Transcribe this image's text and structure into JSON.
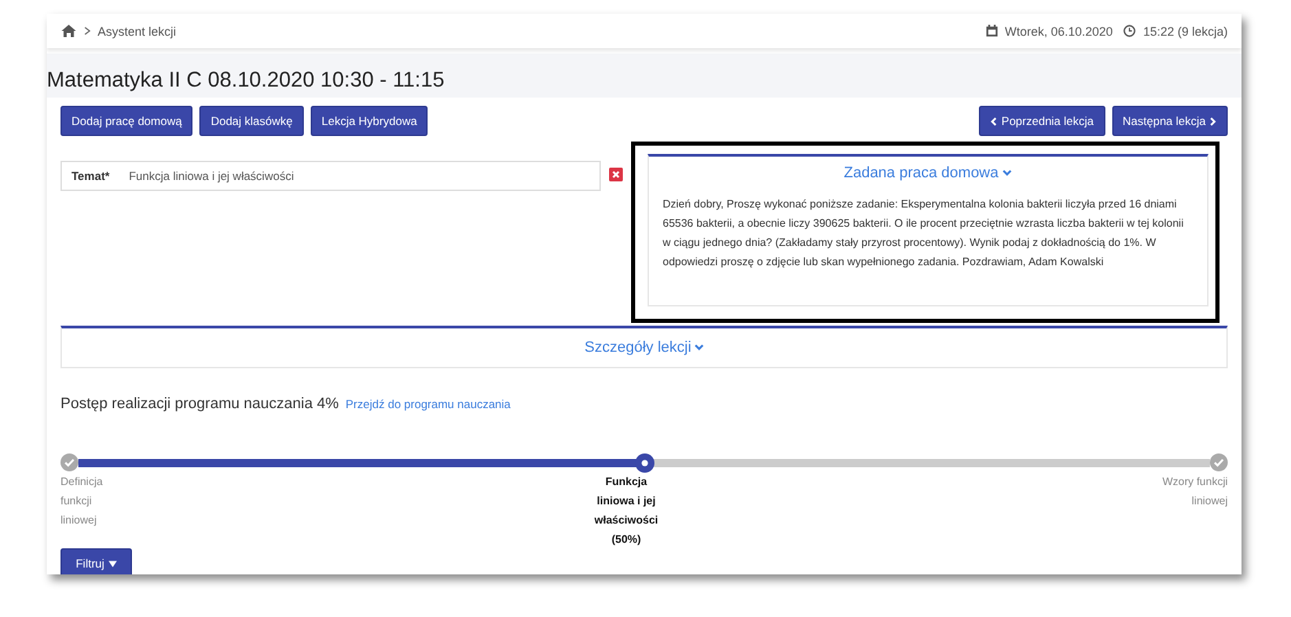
{
  "breadcrumb": {
    "current": "Asystent lekcji"
  },
  "header_info": {
    "date": "Wtorek, 06.10.2020",
    "time": "15:22 (9 lekcja)"
  },
  "title": "Matematyka II C 08.10.2020 10:30 - 11:15",
  "left_buttons": [
    "Dodaj pracę domową",
    "Dodaj klasówkę",
    "Lekcja Hybrydowa"
  ],
  "nav_buttons": [
    {
      "label": "Poprzednia lekcja",
      "kind": "prev"
    },
    {
      "label": "Następna lekcja",
      "kind": "next"
    }
  ],
  "topic": {
    "label": "Temat*",
    "value": "Funkcja liniowa i jej właściwości"
  },
  "homework": {
    "title": "Zadana praca domowa",
    "text": "Dzień dobry, Proszę wykonać poniższe zadanie: Eksperymentalna kolonia bakterii liczyła przed 16 dniami 65536 bakterii, a obecnie liczy 390625 bakterii. O ile procent przeciętnie wzrasta liczba bakterii w tej kolonii w ciągu jednego dnia? (Zakładamy stały przyrost procentowy). Wynik podaj z dokładnością do 1%. W odpowiedzi proszę o zdjęcie lub skan wypełnionego zadania. Pozdrawiam, Adam Kowalski"
  },
  "details": {
    "title": "Szczegóły lekcji"
  },
  "progress": {
    "text": "Postęp realizacji programu nauczania 4%",
    "link": "Przejdź do programu nauczania",
    "level": 0.5,
    "steps": [
      {
        "label": "Definicja funkcji liniowej",
        "kind": "done",
        "selected": false
      },
      {
        "label": "Funkcja liniowa i jej właściwości",
        "percent": "(50%)",
        "kind": "current",
        "selected": true
      },
      {
        "label": "Wzory funkcji liniowej",
        "kind": "done",
        "selected": false
      }
    ]
  },
  "filter_button": "Filtruj"
}
